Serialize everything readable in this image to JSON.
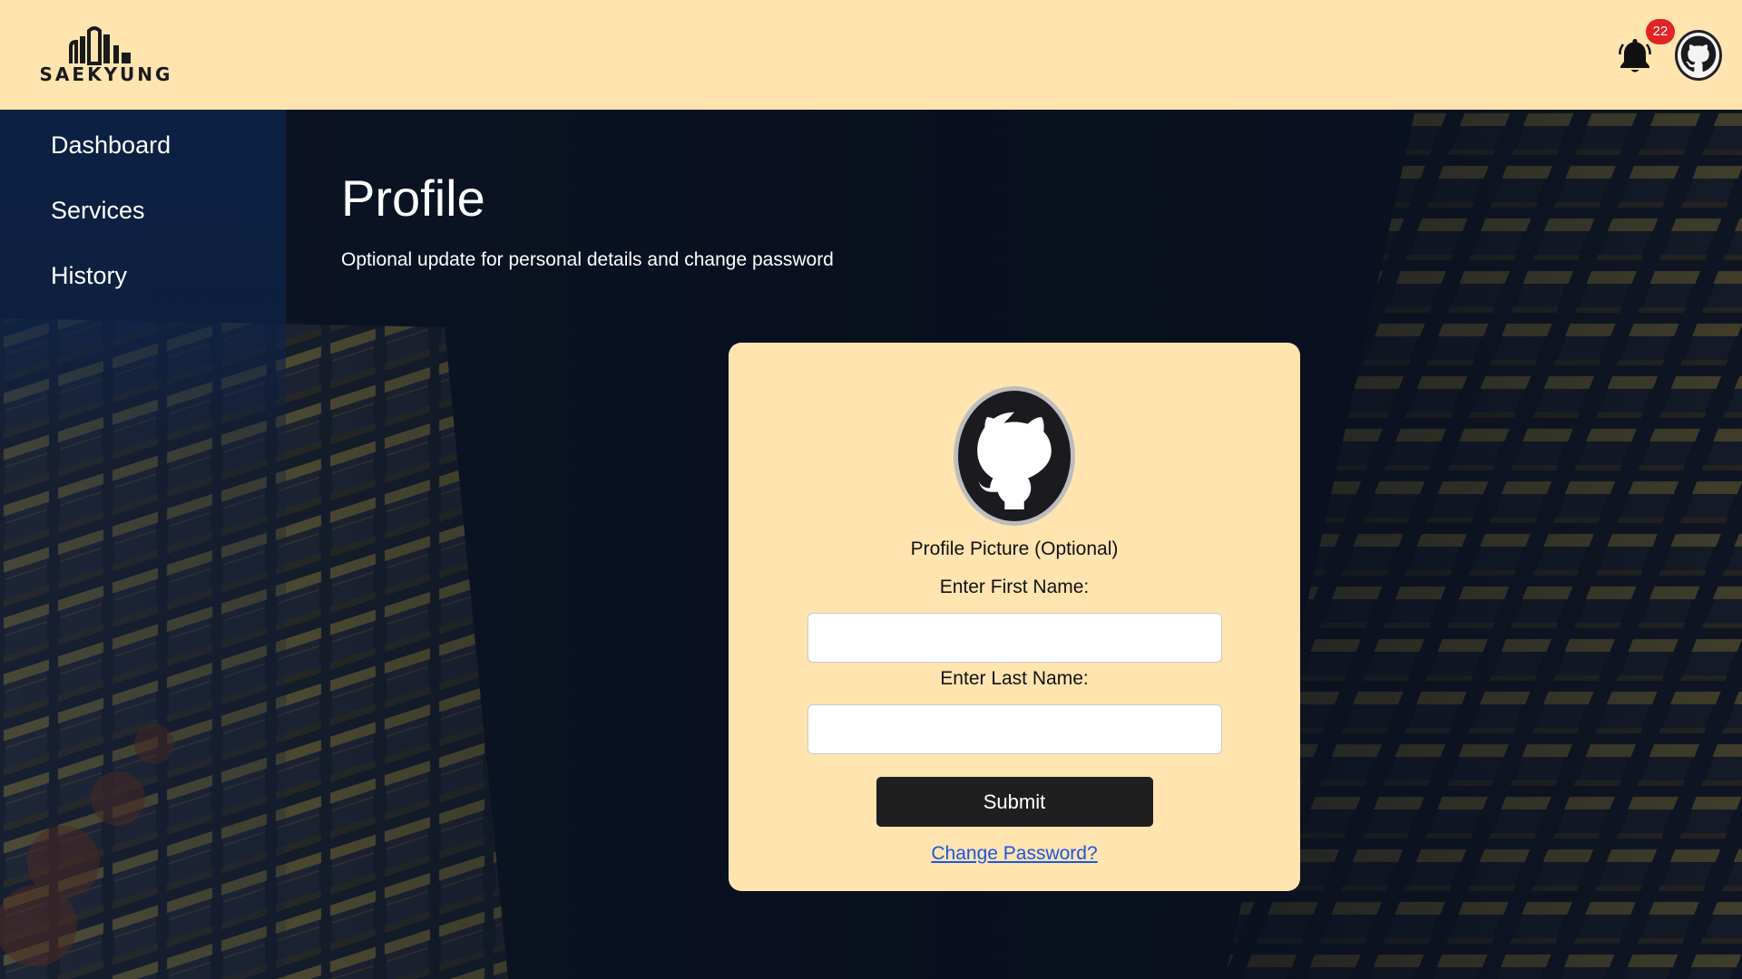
{
  "header": {
    "logo_text": "SAEKYUNG",
    "notification_count": "22"
  },
  "sidebar": {
    "items": [
      {
        "label": "Dashboard"
      },
      {
        "label": "Services"
      },
      {
        "label": "History"
      }
    ]
  },
  "page": {
    "title": "Profile",
    "subtitle": "Optional update for personal details and change password"
  },
  "form": {
    "picture_label": "Profile Picture (Optional)",
    "first_name_label": "Enter First Name:",
    "first_name_value": "",
    "last_name_label": "Enter Last Name:",
    "last_name_value": "",
    "submit_label": "Submit",
    "change_password_label": "Change Password?"
  },
  "colors": {
    "header_bg": "#ffe4b0",
    "card_bg": "#ffe4b0",
    "badge": "#e02424",
    "link": "#1a55e6",
    "button": "#1f1f1f"
  },
  "icons": {
    "bell": "bell-icon",
    "avatar": "github-octocat-icon"
  }
}
